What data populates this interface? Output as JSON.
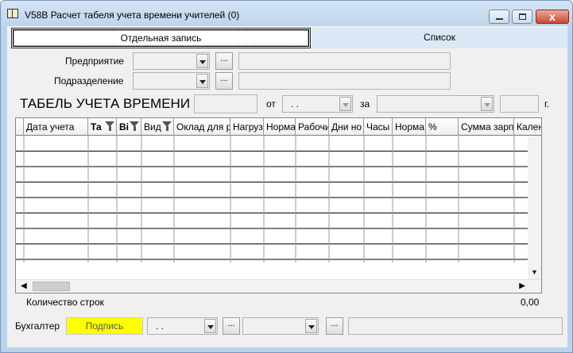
{
  "window": {
    "title": "V58B Расчет табеля учета времени учителей (0)",
    "close_glyph": "x"
  },
  "tabs": {
    "record": "Отдельная запись",
    "list": "Список"
  },
  "form": {
    "enterprise_label": "Предприятие",
    "department_label": "Подразделение",
    "dots": "...",
    "heading": "ТАБЕЛЬ УЧЕТА ВРЕМЕНИ №",
    "from_label": "от",
    "date_placeholder": ". .",
    "for_label": "за",
    "year_suffix": "г."
  },
  "grid": {
    "columns": [
      {
        "label": "Дата учета",
        "bold": false,
        "filter": false
      },
      {
        "label": "Та",
        "bold": true,
        "filter": true
      },
      {
        "label": "Вi",
        "bold": true,
        "filter": true
      },
      {
        "label": "Вид",
        "bold": false,
        "filter": true
      },
      {
        "label": "Оклад для р",
        "bold": false,
        "filter": false
      },
      {
        "label": "Нагрузк",
        "bold": false,
        "filter": false
      },
      {
        "label": "Норма",
        "bold": false,
        "filter": false
      },
      {
        "label": "Рабочи",
        "bold": false,
        "filter": false
      },
      {
        "label": "Дни но",
        "bold": false,
        "filter": false
      },
      {
        "label": "Часы",
        "bold": false,
        "filter": false
      },
      {
        "label": "Норма",
        "bold": false,
        "filter": false
      },
      {
        "label": "%",
        "bold": false,
        "filter": false
      },
      {
        "label": "Сумма зарпл",
        "bold": false,
        "filter": false
      },
      {
        "label": "Календ",
        "bold": false,
        "filter": false
      }
    ],
    "rows_count_label": "Количество строк",
    "total_value": "0,00"
  },
  "footer": {
    "accountant_label": "Бухгалтер",
    "signature_button": "Подпись",
    "date_placeholder": ". .",
    "dots": "..."
  },
  "colors": {
    "signature_bg": "#ffff00",
    "list_tab_bg": "#dbe8f5"
  }
}
